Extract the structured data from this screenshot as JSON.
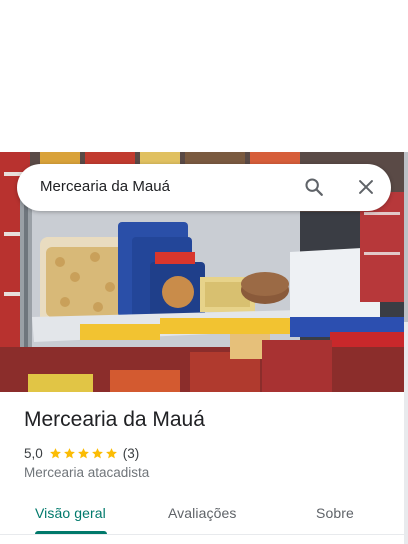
{
  "search": {
    "query": "Mercearia da Mauá",
    "search_icon": "search-icon",
    "close_icon": "close-icon"
  },
  "place": {
    "name": "Mercearia da Mauá",
    "rating": "5,0",
    "stars": 5,
    "review_count": "(3)",
    "category": "Mercearia atacadista",
    "photo": "grocery-shelf-photo"
  },
  "tabs": [
    {
      "label": "Visão geral",
      "active": true
    },
    {
      "label": "Avaliações",
      "active": false
    },
    {
      "label": "Sobre",
      "active": false
    }
  ],
  "colors": {
    "accent": "#00796b",
    "star": "#fbbc04",
    "text_primary": "#202124",
    "text_secondary": "#70757a"
  }
}
